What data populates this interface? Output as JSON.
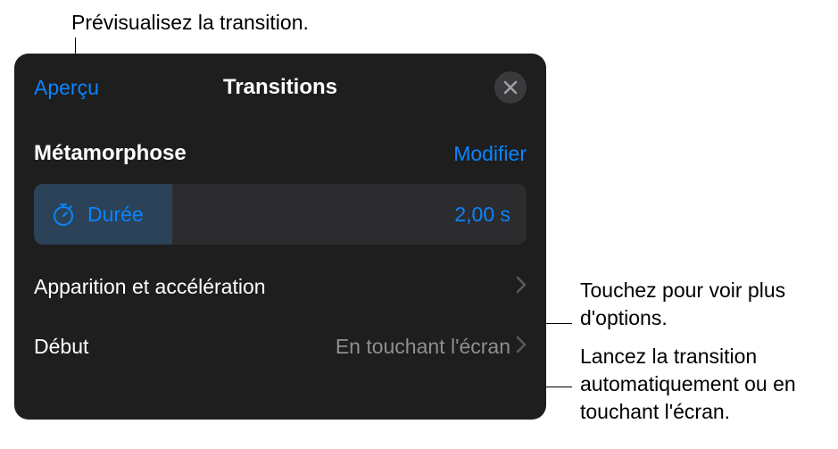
{
  "callouts": {
    "preview": "Prévisualisez la transition.",
    "moreOptions": "Touchez pour voir plus d'options.",
    "startMode": "Lancez la transition automatiquement ou en touchant l'écran."
  },
  "panel": {
    "previewLink": "Aperçu",
    "title": "Transitions",
    "transitionName": "Métamorphose",
    "modifyLink": "Modifier",
    "duration": {
      "label": "Durée",
      "value": "2,00 s"
    },
    "rows": {
      "appearance": {
        "label": "Apparition et accélération"
      },
      "start": {
        "label": "Début",
        "value": "En touchant l'écran"
      }
    }
  }
}
